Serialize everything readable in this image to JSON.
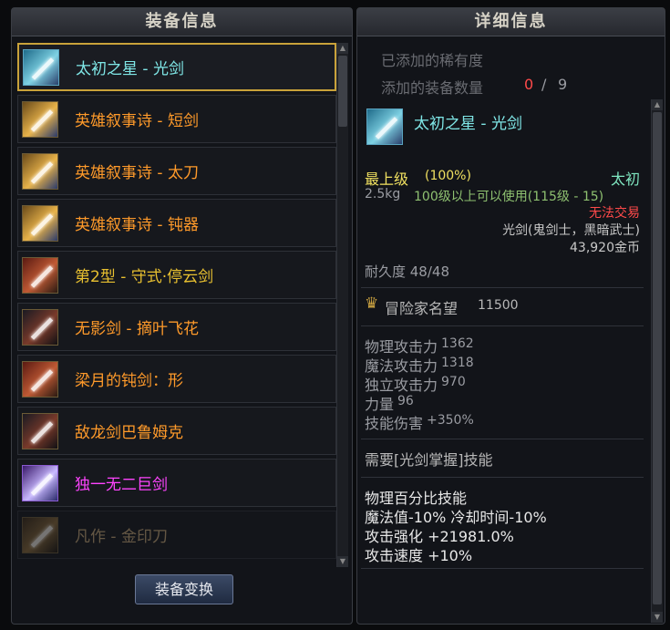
{
  "left_panel": {
    "title": "装备信息",
    "items": [
      {
        "name": "太初之星 - 光剑",
        "color": "#7fe6e6",
        "icon": "light-sword-icon",
        "icon_class": "ic-cyan",
        "selected": true
      },
      {
        "name": "英雄叙事诗 - 短剑",
        "color": "#ff9a2a",
        "icon": "short-sword-icon",
        "icon_class": "ic-gold"
      },
      {
        "name": "英雄叙事诗 - 太刀",
        "color": "#ff9a2a",
        "icon": "katana-icon",
        "icon_class": "ic-gold"
      },
      {
        "name": "英雄叙事诗 - 钝器",
        "color": "#ff9a2a",
        "icon": "blunt-weapon-icon",
        "icon_class": "ic-gold"
      },
      {
        "name": "第2型 - 守式·停云剑",
        "color": "#e8c030",
        "icon": "sword-icon",
        "icon_class": "ic-red"
      },
      {
        "name": "无影剑 - 摘叶飞花",
        "color": "#ff9a2a",
        "icon": "shadow-sword-icon",
        "icon_class": "ic-dark"
      },
      {
        "name": "梁月的钝剑：形",
        "color": "#ff9a2a",
        "icon": "blunt-sword-icon",
        "icon_class": "ic-red"
      },
      {
        "name": "敌龙剑巴鲁姆克",
        "color": "#ff9a2a",
        "icon": "dragon-sword-icon",
        "icon_class": "ic-dark"
      },
      {
        "name": "独一无二巨剑",
        "color": "#ff44ff",
        "icon": "greatsword-icon",
        "icon_class": "ic-purple"
      },
      {
        "name": "凡作 - 金印刀",
        "color": "#c8a878",
        "icon": "blade-icon",
        "icon_class": "ic-brown",
        "faded": true
      }
    ],
    "swap_button": "装备变换"
  },
  "right_panel": {
    "title": "详细信息",
    "rarity_label": "已添加的稀有度",
    "equip_count_label": "添加的装备数量",
    "equip_count_current": "0",
    "equip_count_sep": "/",
    "equip_count_max": "9",
    "item_name": "太初之星 - 光剑",
    "grade": "最上级",
    "grade_pct": "(100%)",
    "rarity": "太初",
    "weight": "2.5kg",
    "level_req": "100级以上可以使用(115级 - 15)",
    "trade": "无法交易",
    "item_type": "光剑(鬼剑士，黑暗武士)",
    "price": "43,920金币",
    "durability": "耐久度 48/48",
    "fame_label": "冒险家名望",
    "fame_value": "11500",
    "stats": [
      {
        "label": "物理攻击力",
        "value": "1362"
      },
      {
        "label": "魔法攻击力",
        "value": "1318"
      },
      {
        "label": "独立攻击力",
        "value": "970"
      },
      {
        "label": "力量",
        "value": "96"
      },
      {
        "label": "技能伤害",
        "value": "+350%"
      }
    ],
    "skill_req": "需要[光剑掌握]技能",
    "effects": [
      "物理百分比技能",
      " 魔法值-10% 冷却时间-10%",
      "攻击强化 +21981.0%",
      "攻击速度 +10%"
    ]
  },
  "colors": {
    "item_name_cyan": "#7fe6e6",
    "epic_orange": "#ff9a2a",
    "unique_pink": "#ff44ff",
    "grade_gold": "#f0e060",
    "level_green": "#8ec070",
    "trade_red": "#ff4a4a",
    "count_red": "#ff4a4a",
    "rarity_green": "#7fe6c0"
  }
}
